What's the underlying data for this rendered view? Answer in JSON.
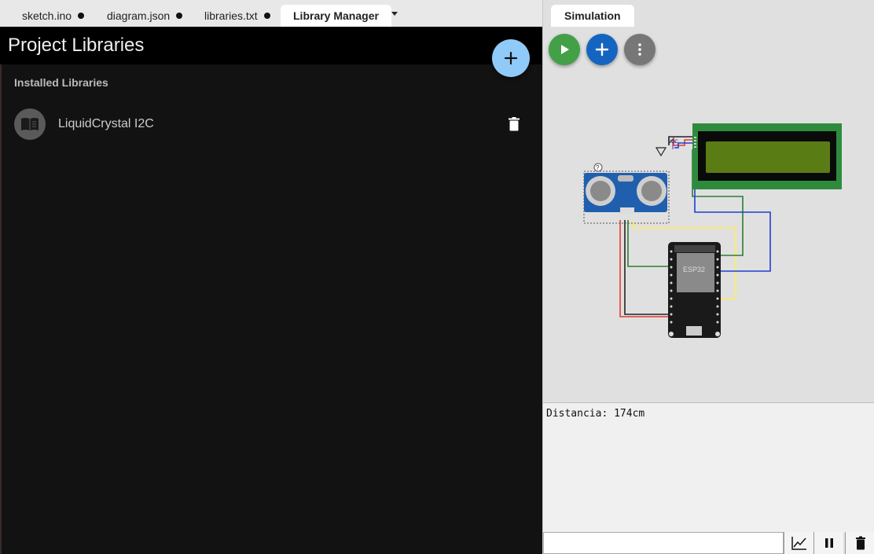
{
  "editor_tabs": [
    {
      "label": "sketch.ino",
      "modified": true
    },
    {
      "label": "diagram.json",
      "modified": true
    },
    {
      "label": "libraries.txt",
      "modified": true
    },
    {
      "label": "Library Manager",
      "modified": false,
      "active": true
    }
  ],
  "library_manager": {
    "title": "Project Libraries",
    "section_label": "Installed Libraries",
    "libraries": [
      {
        "name": "LiquidCrystal I2C",
        "icon": "book-icon"
      }
    ],
    "add_icon": "plus-icon",
    "delete_icon": "trash-icon"
  },
  "simulation": {
    "tab_label": "Simulation",
    "buttons": [
      {
        "name": "play",
        "icon": "play-icon",
        "color": "#43a047"
      },
      {
        "name": "add-part",
        "icon": "plus-icon",
        "color": "#1565c0"
      },
      {
        "name": "more",
        "icon": "more-vert-icon",
        "color": "#777777"
      }
    ],
    "diagram": {
      "parts": [
        "ultrasonic-sensor",
        "lcd-display",
        "esp32-board"
      ],
      "esp32_label": "ESP32",
      "vcc_label": "VCC",
      "help_mark": "?"
    }
  },
  "serial_monitor": {
    "output": "Distancia: 174cm",
    "input_value": "",
    "buttons": [
      {
        "name": "plotter",
        "icon": "chart-icon"
      },
      {
        "name": "pause",
        "icon": "pause-icon"
      },
      {
        "name": "clear",
        "icon": "trash-icon"
      }
    ]
  },
  "colors": {
    "accent_fab": "#90caf9",
    "dark_bg": "#121212",
    "lcd_green": "#2e8b3e"
  }
}
